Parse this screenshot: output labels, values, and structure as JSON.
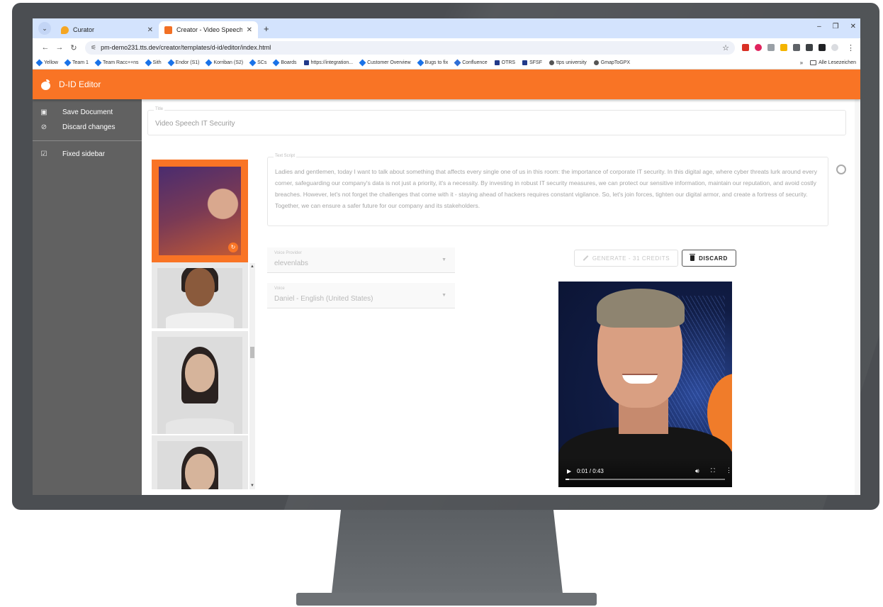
{
  "browser": {
    "tabs": [
      {
        "title": "Curator"
      },
      {
        "title": "Creator - Video Speech IT Secu"
      }
    ],
    "url": "pm-demo231.tts.dev/creator/templates/d-id/editor/index.html",
    "bookmarks": [
      "Yellow",
      "Team 1",
      "Team Racc++ns",
      "Sith",
      "Endor (S1)",
      "Korriban (S2)",
      "SCs",
      "Boards",
      "https://integration...",
      "Customer Overview",
      "Bugs to fix",
      "Confluence",
      "OTRS",
      "SFSF",
      "ttps university",
      "GmapToGPX"
    ],
    "bookmarks_overflow": "»",
    "bookmarks_folder": "Alle Lesezeichen"
  },
  "app": {
    "title": "D-ID Editor",
    "brand_color": "#f97425"
  },
  "sidebar": {
    "items": [
      {
        "label": "Save Document",
        "icon": "floppy-icon"
      },
      {
        "label": "Discard changes",
        "icon": "block-icon"
      },
      {
        "label": "Fixed sidebar",
        "icon": "checkbox-icon"
      }
    ]
  },
  "editor": {
    "title_label": "Title",
    "title_value": "Video Speech IT Security",
    "script_label": "Text Script",
    "script_text": "Ladies and gentlemen, today I want to talk about something that affects every single one of us in this room: the importance of corporate IT security. In this digital age, where cyber threats lurk around every corner, safeguarding our company's data is not just a priority, it's a necessity. By investing in robust IT security measures, we can protect our sensitive information, maintain our reputation, and avoid costly breaches. However, let's not forget the challenges that come with it - staying ahead of hackers requires constant vigilance. So, let's join forces, tighten our digital armor, and create a fortress of security. Together, we can ensure a safer future for our company and its stakeholders.",
    "voice_provider_label": "Voice Provider",
    "voice_provider_value": "elevenlabs",
    "voice_label": "Voice",
    "voice_value": "Daniel - English (United States)",
    "generate_label": "GENERATE - 31 CREDITS",
    "discard_label": "DISCARD"
  },
  "video": {
    "time": "0:01 / 0:43",
    "progress": 0.02
  }
}
